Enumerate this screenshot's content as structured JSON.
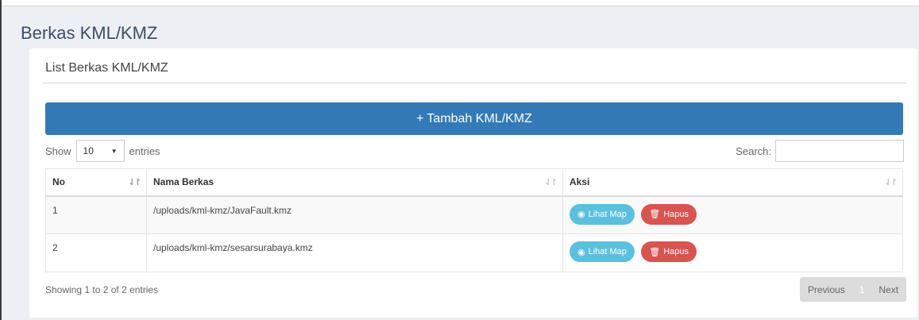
{
  "page": {
    "title": "Berkas KML/KMZ"
  },
  "box": {
    "title": "List Berkas KML/KMZ"
  },
  "add_button": {
    "icon": "+",
    "label": "Tambah KML/KMZ",
    "color": "#337ab7"
  },
  "length_control": {
    "prefix": "Show",
    "value": "10",
    "suffix": "entries"
  },
  "search": {
    "label": "Search:",
    "value": ""
  },
  "table": {
    "columns": [
      "No",
      "Nama Berkas",
      "Aksi"
    ],
    "rows": [
      {
        "no": "1",
        "name": "/uploads/kml-kmz/JavaFault.kmz",
        "view": "Lihat Map",
        "delete": "Hapus"
      },
      {
        "no": "2",
        "name": "/uploads/kml-kmz/sesarsurabaya.kmz",
        "view": "Lihat Map",
        "delete": "Hapus"
      }
    ]
  },
  "footer": {
    "info": "Showing 1 to 2 of 2 entries"
  },
  "pagination": {
    "previous": "Previous",
    "current": "1",
    "next": "Next"
  },
  "colors": {
    "info": "#5bc0de",
    "danger": "#d9534f",
    "background": "#ecf0f5"
  }
}
